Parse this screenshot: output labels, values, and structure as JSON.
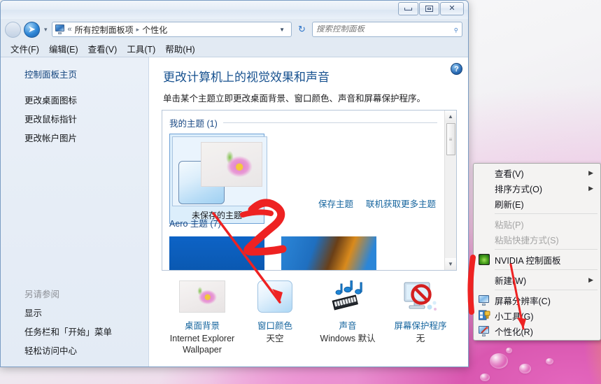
{
  "window": {
    "title": "",
    "buttons": {
      "minimize": "minimize-button",
      "maximize": "maximize-button",
      "close": "close-button"
    }
  },
  "address": {
    "back": "◀",
    "forward": "➤",
    "dropdown": "▾",
    "icon": "control-panel-icon",
    "separator_first": "«",
    "crumbs": [
      "所有控制面板项",
      "个性化"
    ],
    "crumb_sep": "▸",
    "caret": "▼",
    "refresh": "↻"
  },
  "search": {
    "placeholder": "搜索控制面板",
    "value": "",
    "icon": "search-icon"
  },
  "menubar": {
    "items": [
      "文件(F)",
      "编辑(E)",
      "查看(V)",
      "工具(T)",
      "帮助(H)"
    ]
  },
  "sidebar": {
    "home": "控制面板主页",
    "links": [
      "更改桌面图标",
      "更改鼠标指针",
      "更改帐户图片"
    ],
    "see_also_label": "另请参阅",
    "see_also": [
      "显示",
      "任务栏和「开始」菜单",
      "轻松访问中心"
    ]
  },
  "content": {
    "help": "?",
    "heading": "更改计算机上的视觉效果和声音",
    "subheading": "单击某个主题立即更改桌面背景、窗口颜色、声音和屏幕保护程序。",
    "groups": [
      {
        "label": "我的主题 (1)",
        "theme_name": "未保存的主题"
      },
      {
        "label": "Aero 主题 (7)"
      }
    ],
    "links": [
      "保存主题",
      "联机获取更多主题"
    ],
    "scrollbar": {
      "up": "▲",
      "down": "▼",
      "grip": "≡"
    }
  },
  "settings_row": [
    {
      "name": "桌面背景",
      "value": "Internet Explorer Wallpaper",
      "icon": "desktop-background-icon"
    },
    {
      "name": "窗口颜色",
      "value": "天空",
      "icon": "window-color-icon"
    },
    {
      "name": "声音",
      "value": "Windows 默认",
      "icon": "sound-icon"
    },
    {
      "name": "屏幕保护程序",
      "value": "无",
      "icon": "screensaver-icon"
    }
  ],
  "context_menu": {
    "items": [
      {
        "label": "查看(V)",
        "submenu": "▶",
        "disabled": false,
        "icon": ""
      },
      {
        "label": "排序方式(O)",
        "submenu": "▶",
        "disabled": false,
        "icon": ""
      },
      {
        "label": "刷新(E)",
        "submenu": "",
        "disabled": false,
        "icon": ""
      },
      {
        "label": "粘贴(P)",
        "submenu": "",
        "disabled": true,
        "icon": ""
      },
      {
        "label": "粘贴快捷方式(S)",
        "submenu": "",
        "disabled": true,
        "icon": ""
      },
      {
        "label": "NVIDIA 控制面板",
        "submenu": "",
        "disabled": false,
        "icon": "nvidia-icon"
      },
      {
        "label": "新建(W)",
        "submenu": "▶",
        "disabled": false,
        "icon": ""
      },
      {
        "label": "屏幕分辨率(C)",
        "submenu": "",
        "disabled": false,
        "icon": "monitor-icon"
      },
      {
        "label": "小工具(G)",
        "submenu": "",
        "disabled": false,
        "icon": "gadget-icon"
      },
      {
        "label": "个性化(R)",
        "submenu": "",
        "disabled": false,
        "icon": "personalize-icon"
      }
    ]
  },
  "annotations": {
    "step_number": "2",
    "ink_color": "#ee2222"
  }
}
